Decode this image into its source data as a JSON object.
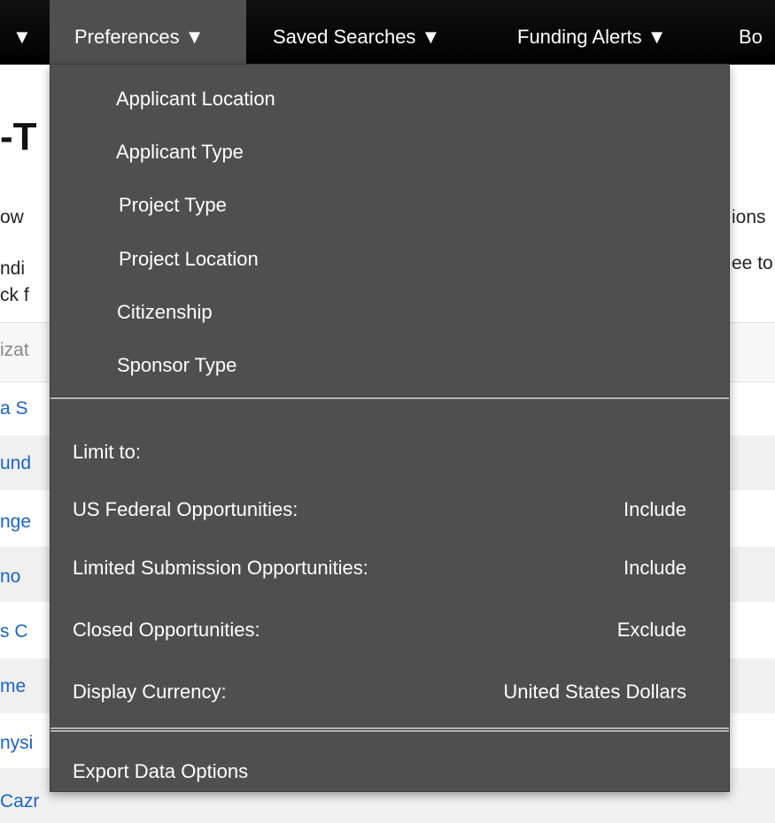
{
  "nav": {
    "prev_arrow": "▼",
    "items": [
      {
        "label": "Preferences ▼"
      },
      {
        "label": "Saved Searches ▼"
      },
      {
        "label": "Funding Alerts ▼"
      },
      {
        "label": "Bo"
      }
    ]
  },
  "background": {
    "heading": "-T",
    "text_lines": [
      "ow",
      "ndi",
      "ck f"
    ],
    "right_fragments": [
      "ions",
      "ee to"
    ],
    "table_header": "izat",
    "rows": [
      "a S",
      "und",
      "nge",
      "no",
      "s C",
      "me",
      "nysi",
      "Cazr"
    ]
  },
  "dropdown": {
    "preferences": [
      "Applicant Location",
      "Applicant Type",
      "Project Type",
      "Project Location",
      "Citizenship",
      "Sponsor Type"
    ],
    "limit_label": "Limit to:",
    "settings": [
      {
        "label": "US Federal Opportunities:",
        "value": "Include"
      },
      {
        "label": "Limited Submission Opportunities:",
        "value": "Include"
      },
      {
        "label": "Closed Opportunities:",
        "value": "Exclude"
      },
      {
        "label": "Display Currency:",
        "value": "United States Dollars"
      }
    ],
    "export_label": "Export Data Options"
  }
}
